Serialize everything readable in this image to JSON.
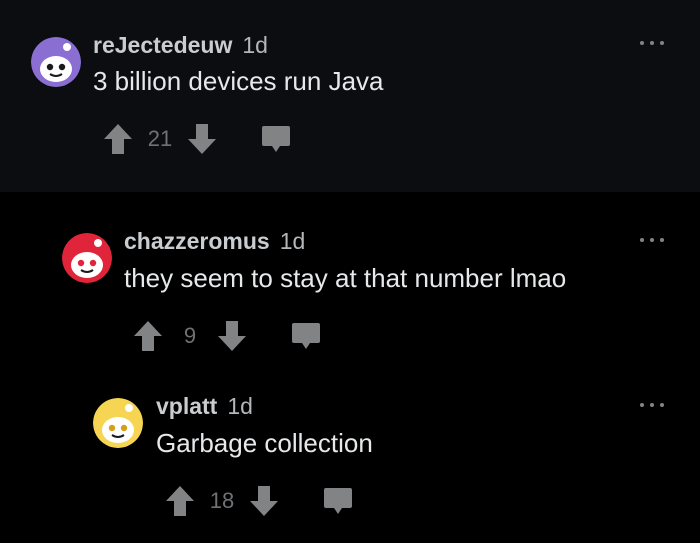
{
  "colors": {
    "background": "#000000",
    "top_panel": "#0b0d10",
    "text": "#e6e8ea",
    "muted": "#6f7275",
    "icon": "#818384"
  },
  "comments": [
    {
      "username": "reJectedeuw",
      "age": "1d",
      "text": "3 billion devices run Java",
      "score": "21",
      "avatar_color": "#8a6ed1"
    },
    {
      "username": "chazzeromus",
      "age": "1d",
      "text": "they seem to stay at that number lmao",
      "score": "9",
      "avatar_color": "#e0243a"
    },
    {
      "username": "vplatt",
      "age": "1d",
      "text": "Garbage collection",
      "score": "18",
      "avatar_color": "#f5d552"
    }
  ]
}
